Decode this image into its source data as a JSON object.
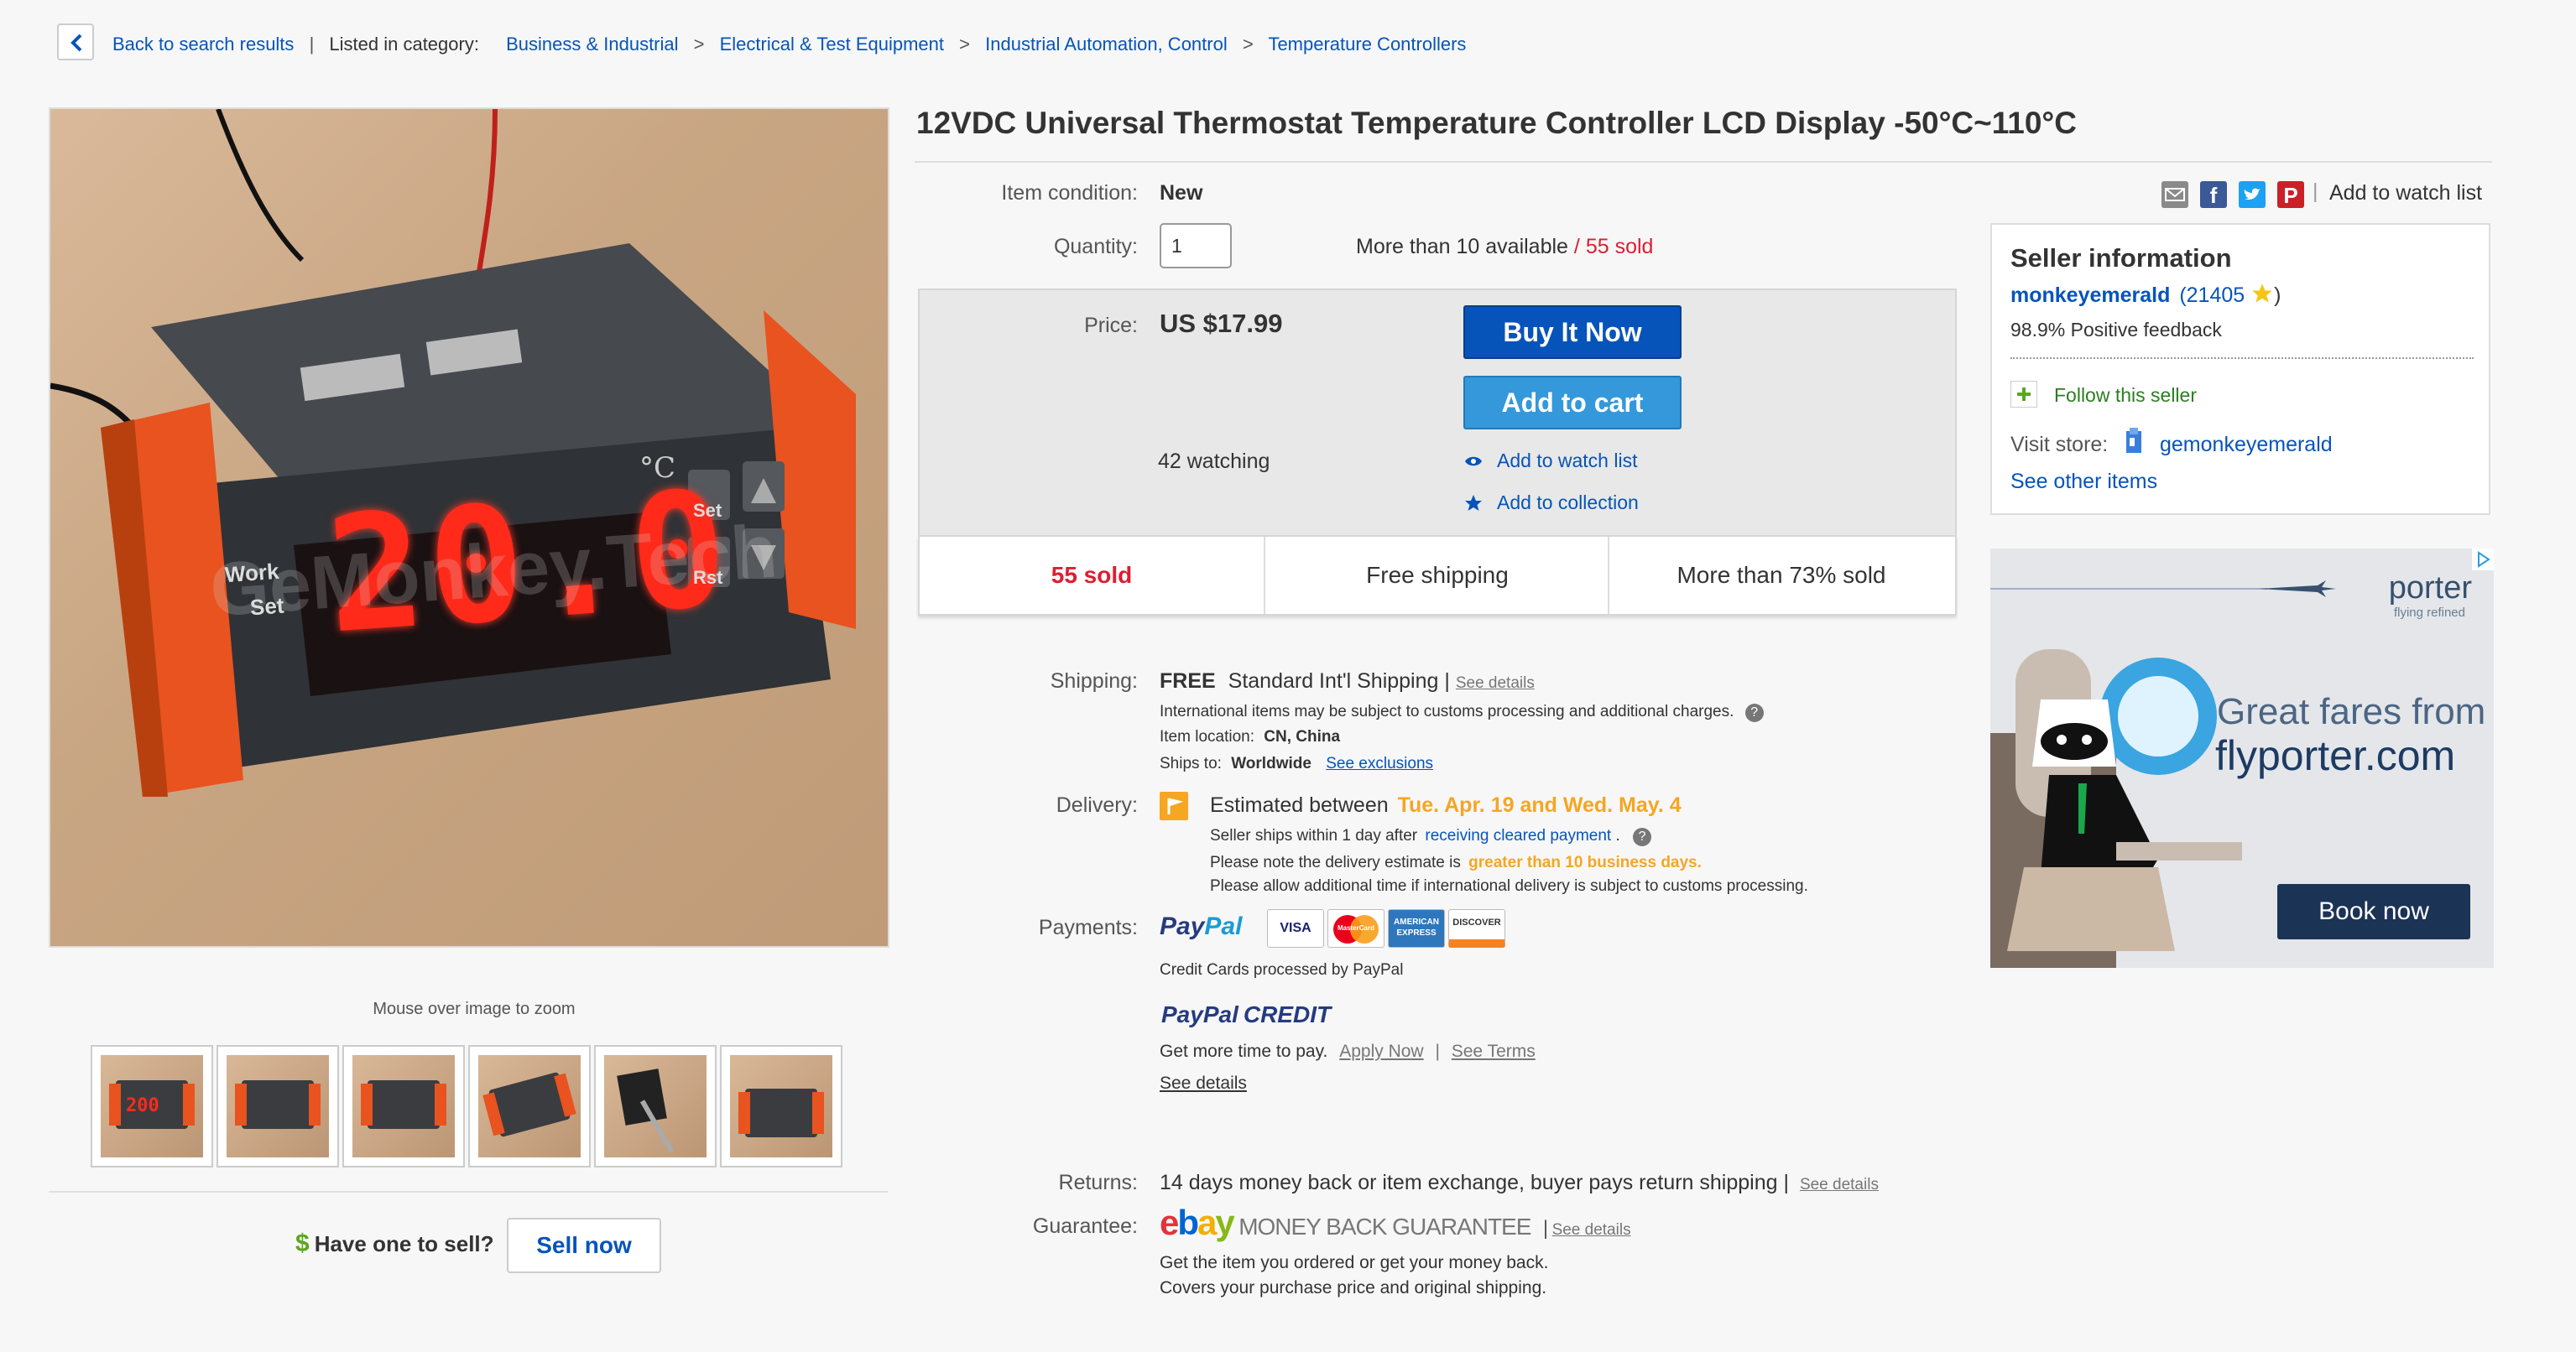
{
  "breadcrumb": {
    "back": "Back to search results",
    "listed_in": "Listed in category:",
    "categories": [
      "Business & Industrial",
      "Electrical & Test Equipment",
      "Industrial Automation, Control",
      "Temperature Controllers"
    ],
    "separator": ">"
  },
  "gallery": {
    "display_value": "20.0",
    "unit": "°C",
    "labels": [
      "Work",
      "Set",
      "Set",
      "Rst"
    ],
    "watermark": "GeMonkey.Tech",
    "zoom_hint": "Mouse over image to zoom",
    "thumb_display": "200"
  },
  "sell": {
    "dollar": "$",
    "question": "Have one to sell?",
    "button": "Sell now"
  },
  "item": {
    "title": "12VDC Universal Thermostat Temperature Controller LCD Display -50°C~110°C",
    "condition_label": "Item condition:",
    "condition": "New",
    "quantity_label": "Quantity:",
    "quantity": "1",
    "available": "More than 10 available",
    "slash": "/",
    "sold": "55 sold"
  },
  "share": {
    "add_to_watch": "Add to watch list",
    "divider": "|"
  },
  "price": {
    "label": "Price:",
    "value": "US $17.99",
    "buy_now": "Buy It Now",
    "add_to_cart": "Add to cart",
    "watching": "42 watching",
    "watch_link": "Add to watch list",
    "collection_link": "Add to collection"
  },
  "stats": [
    "55 sold",
    "Free shipping",
    "More than 73% sold"
  ],
  "shipping": {
    "label": "Shipping:",
    "free": "FREE",
    "service": "Standard Int'l Shipping",
    "see_details": "See details",
    "customs_note": "International items may be subject to customs processing and additional charges.",
    "location_label": "Item location:",
    "location": "CN, China",
    "ships_to_label": "Ships to:",
    "ships_to": "Worldwide",
    "exclusions": "See exclusions"
  },
  "delivery": {
    "label": "Delivery:",
    "estimated": "Estimated between",
    "dates": "Tue. Apr. 19 and Wed. May. 4",
    "seller_ships": "Seller ships within 1 day after",
    "cleared_payment": "receiving cleared payment",
    "period": ".",
    "note_prefix": "Please note the delivery estimate is",
    "note_highlight": "greater than 10 business days.",
    "note2": "Please allow additional time if international delivery is subject to customs processing."
  },
  "payments": {
    "label": "Payments:",
    "paypal_1": "Pay",
    "paypal_2": "Pal",
    "cards": [
      "VISA",
      "MasterCard",
      "AMERICAN EXPRESS",
      "DISCOVER"
    ],
    "processed": "Credit Cards processed by PayPal",
    "credit_1": "PayPal",
    "credit_2": "CREDIT",
    "more_time": "Get more time to pay.",
    "apply_now": "Apply Now",
    "see_terms": "See Terms",
    "see_details": "See details"
  },
  "returns": {
    "label": "Returns:",
    "text": "14 days money back or item exchange, buyer pays return shipping",
    "see_details": "See details"
  },
  "guarantee": {
    "label": "Guarantee:",
    "mbg": "MONEY BACK GUARANTEE",
    "see_details": "See details",
    "line1": "Get the item you ordered or get your money back.",
    "line2": "Covers your purchase price and original shipping."
  },
  "seller": {
    "heading": "Seller information",
    "name": "monkeyemerald",
    "score": "21405",
    "feedback": "98.9% Positive feedback",
    "follow": "Follow this seller",
    "visit_store": "Visit store:",
    "store": "gemonkeyemerald",
    "other_items": "See other items"
  },
  "ad": {
    "brand": "porter",
    "tagline": "flying refined",
    "line1": "Great fares from",
    "line2": "flyporter.com",
    "cta": "Book now"
  },
  "colors": {
    "link": "#0654ba",
    "sold_red": "#dd1e31",
    "orange": "#f5a623",
    "buy_now": "#0654ba",
    "add_to_cart": "#3498db"
  }
}
